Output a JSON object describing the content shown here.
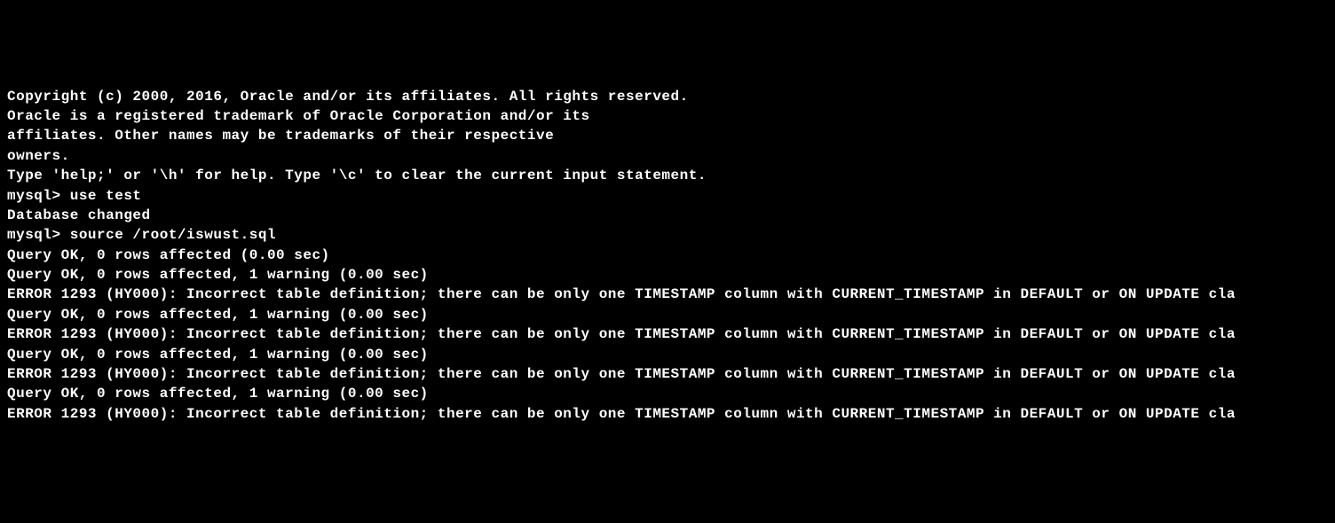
{
  "lines": [
    "Copyright (c) 2000, 2016, Oracle and/or its affiliates. All rights reserved.",
    "",
    "Oracle is a registered trademark of Oracle Corporation and/or its",
    "affiliates. Other names may be trademarks of their respective",
    "owners.",
    "",
    "Type 'help;' or '\\h' for help. Type '\\c' to clear the current input statement.",
    "",
    "mysql> use test",
    "Database changed",
    "mysql> source /root/iswust.sql",
    "Query OK, 0 rows affected (0.00 sec)",
    "",
    "Query OK, 0 rows affected, 1 warning (0.00 sec)",
    "",
    "ERROR 1293 (HY000): Incorrect table definition; there can be only one TIMESTAMP column with CURRENT_TIMESTAMP in DEFAULT or ON UPDATE cla",
    "Query OK, 0 rows affected, 1 warning (0.00 sec)",
    "",
    "ERROR 1293 (HY000): Incorrect table definition; there can be only one TIMESTAMP column with CURRENT_TIMESTAMP in DEFAULT or ON UPDATE cla",
    "Query OK, 0 rows affected, 1 warning (0.00 sec)",
    "",
    "ERROR 1293 (HY000): Incorrect table definition; there can be only one TIMESTAMP column with CURRENT_TIMESTAMP in DEFAULT or ON UPDATE cla",
    "Query OK, 0 rows affected, 1 warning (0.00 sec)",
    "",
    "ERROR 1293 (HY000): Incorrect table definition; there can be only one TIMESTAMP column with CURRENT_TIMESTAMP in DEFAULT or ON UPDATE cla"
  ]
}
